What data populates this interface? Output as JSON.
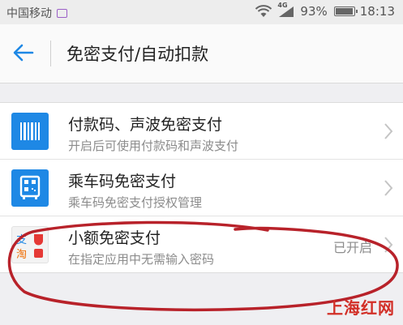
{
  "status_bar": {
    "carrier": "中国移动",
    "network": "4G",
    "battery": "93%",
    "time": "18:13"
  },
  "header": {
    "title": "免密支付/自动扣款"
  },
  "items": [
    {
      "title": "付款码、声波免密支付",
      "subtitle": "开启后可使用付款码和声波支付",
      "status": "",
      "icon": "barcode-icon"
    },
    {
      "title": "乘车码免密支付",
      "subtitle": "乘车码免密支付授权管理",
      "status": "",
      "icon": "bus-qr-icon"
    },
    {
      "title": "小额免密支付",
      "subtitle": "在指定应用中无需输入密码",
      "status": "已开启",
      "icon": "alipay-taobao-icon",
      "icon_chars": [
        "支",
        "淘"
      ]
    }
  ],
  "watermark": "上海红网",
  "colors": {
    "accent": "#1e88e5",
    "annotation": "#b8222a"
  }
}
